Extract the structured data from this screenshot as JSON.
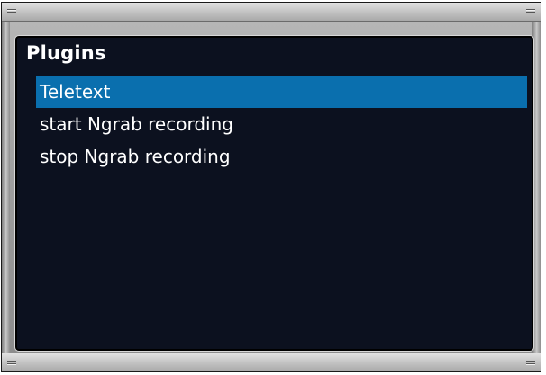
{
  "menu": {
    "title": "Plugins",
    "items": [
      {
        "label": "Teletext",
        "selected": true
      },
      {
        "label": "start Ngrab recording",
        "selected": false
      },
      {
        "label": "stop Ngrab recording",
        "selected": false
      }
    ]
  },
  "colors": {
    "screen_background": "#0c111f",
    "selection_highlight": "#0a6fae",
    "text": "#ffffff",
    "frame": "#9d9d9d"
  }
}
